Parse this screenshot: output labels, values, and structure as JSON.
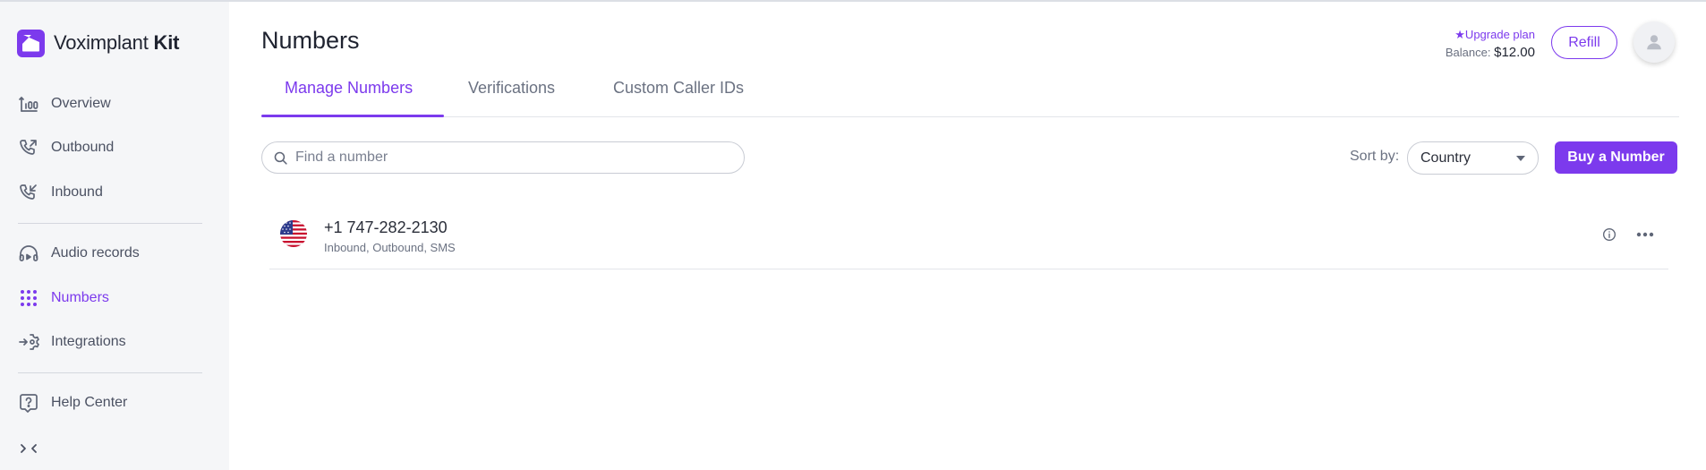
{
  "app": {
    "brand_name": "Voximplant",
    "brand_suffix": "Kit",
    "accent_color": "#7c3aed"
  },
  "sidebar": {
    "items": [
      {
        "label": "Overview",
        "icon": "overview-chart-icon"
      },
      {
        "label": "Outbound",
        "icon": "outbound-phone-icon"
      },
      {
        "label": "Inbound",
        "icon": "inbound-phone-icon"
      },
      {
        "label": "Audio records",
        "icon": "headphones-play-icon"
      },
      {
        "label": "Numbers",
        "icon": "numbers-dialpad-icon",
        "active": true
      },
      {
        "label": "Integrations",
        "icon": "integrations-gear-icon"
      },
      {
        "label": "Help Center",
        "icon": "help-question-icon"
      }
    ],
    "collapse_icon": "collapse-arrows-icon"
  },
  "header": {
    "title": "Numbers",
    "upgrade_label": "★Upgrade plan",
    "balance_label": "Balance:",
    "balance_value": "$12.00",
    "refill_label": "Refill"
  },
  "tabs": [
    {
      "label": "Manage Numbers",
      "active": true
    },
    {
      "label": "Verifications"
    },
    {
      "label": "Custom Caller IDs"
    }
  ],
  "toolbar": {
    "search_placeholder": "Find a number",
    "sort_label": "Sort by:",
    "sort_value": "Country",
    "buy_label": "Buy a Number"
  },
  "numbers": [
    {
      "number": "+1 747-282-2130",
      "capabilities": "Inbound, Outbound, SMS",
      "flag": "us-flag-icon"
    }
  ]
}
